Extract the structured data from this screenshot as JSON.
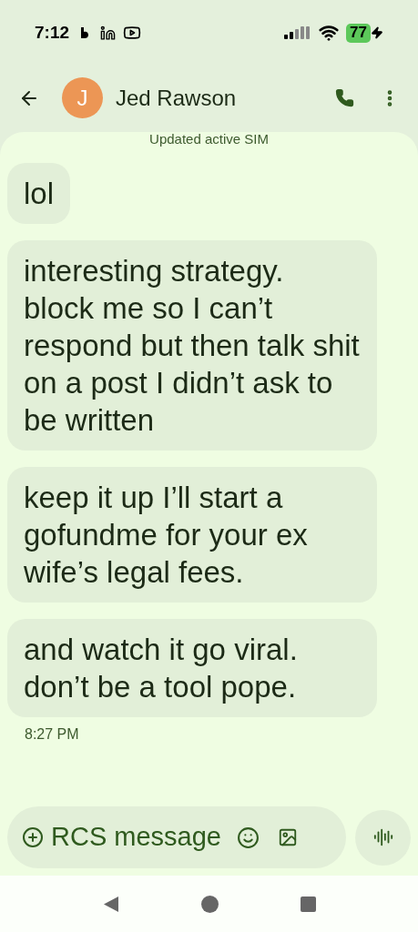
{
  "status_bar": {
    "time": "7:12",
    "battery": "77"
  },
  "header": {
    "avatar_letter": "J",
    "contact_name": "Jed Rawson"
  },
  "system_note": "Updated active SIM",
  "messages": [
    {
      "text": "lol"
    },
    {
      "text": "interesting strategy. block me so I can’t respond but then talk shit on a post I didn’t ask to be written"
    },
    {
      "text": "keep it up I’ll start a gofundme for your ex wife’s legal fees."
    },
    {
      "text": "and watch it go viral. don’t be a tool pope."
    }
  ],
  "timestamp": "8:27 PM",
  "composer": {
    "placeholder": "RCS message"
  }
}
